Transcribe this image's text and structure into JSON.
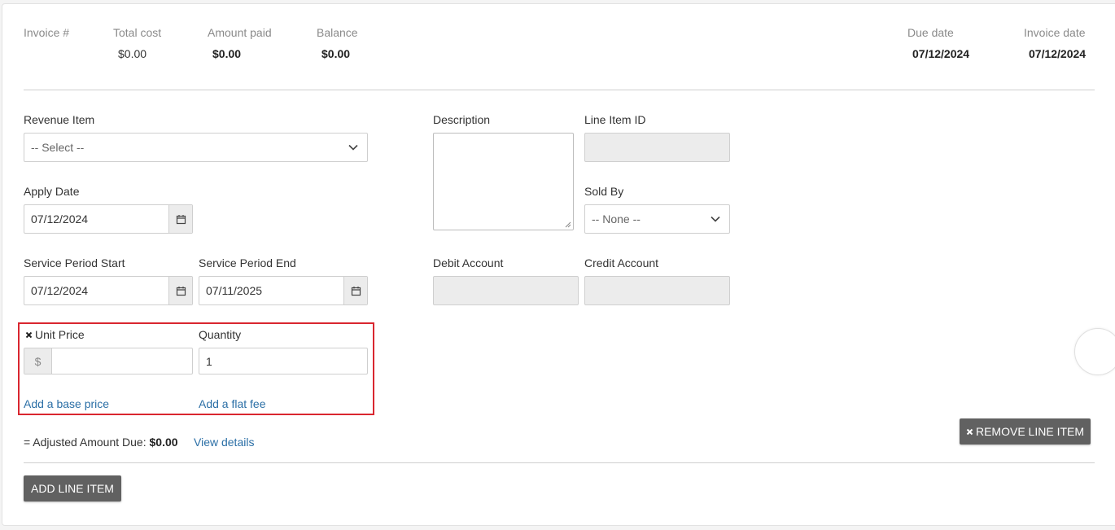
{
  "summary": {
    "invoice_label": "Invoice #",
    "total_cost_label": "Total cost",
    "total_cost_value": "$0.00",
    "amount_paid_label": "Amount paid",
    "amount_paid_value": "$0.00",
    "balance_label": "Balance",
    "balance_value": "$0.00",
    "due_date_label": "Due date",
    "due_date_value": "07/12/2024",
    "invoice_date_label": "Invoice date",
    "invoice_date_value": "07/12/2024"
  },
  "form": {
    "revenue_item_label": "Revenue Item",
    "revenue_item_value": "-- Select --",
    "description_label": "Description",
    "line_item_id_label": "Line Item ID",
    "apply_date_label": "Apply Date",
    "apply_date_value": "07/12/2024",
    "sold_by_label": "Sold By",
    "sold_by_value": "-- None --",
    "service_start_label": "Service Period Start",
    "service_start_value": "07/12/2024",
    "service_end_label": "Service Period End",
    "service_end_value": "07/11/2025",
    "debit_account_label": "Debit Account",
    "credit_account_label": "Credit Account",
    "unit_price_label": "Unit Price",
    "unit_price_prefix": "$",
    "quantity_label": "Quantity",
    "quantity_value": "1",
    "add_base_price": "Add a base price",
    "add_flat_fee": "Add a flat fee",
    "adjusted_prefix": "= Adjusted Amount Due:",
    "adjusted_value": "$0.00",
    "view_details": "View details",
    "remove_line_item": "REMOVE LINE ITEM",
    "add_line_item": "ADD LINE ITEM"
  },
  "colors": {
    "highlight": "#d9262f",
    "link": "#2b6fa6",
    "button": "#616161"
  }
}
